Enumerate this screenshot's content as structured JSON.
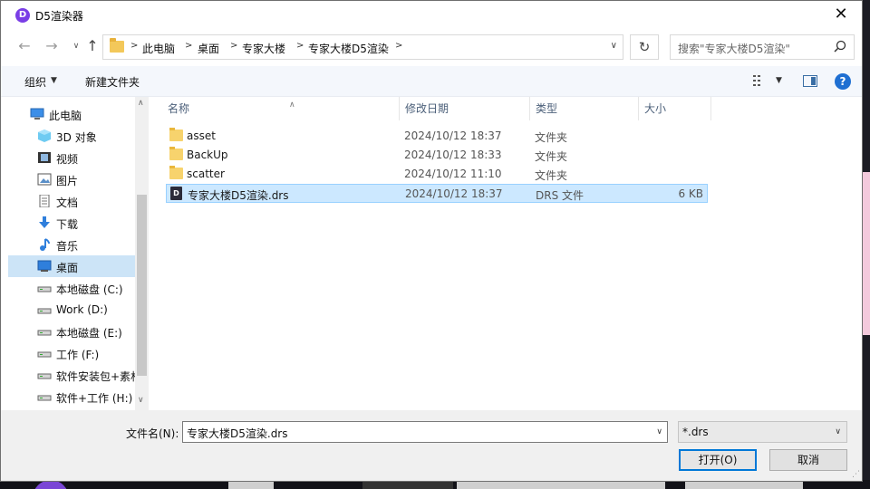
{
  "window": {
    "title": "D5渲染器",
    "app_icon": "D",
    "close_glyph": "✕"
  },
  "nav": {
    "back_glyph": "←",
    "forward_glyph": "→",
    "recent_glyph": "∨",
    "up_glyph": "↑",
    "refresh_glyph": "↻",
    "breadcrumbs": [
      "此电脑",
      "桌面",
      "专家大楼",
      "专家大楼D5渲染"
    ],
    "search_placeholder": "搜索\"专家大楼D5渲染\""
  },
  "toolbar": {
    "organize_label": "组织",
    "new_folder_label": "新建文件夹",
    "help_glyph": "?"
  },
  "sidebar": {
    "items": [
      {
        "label": "此电脑",
        "icon": "computer-icon",
        "root": true
      },
      {
        "label": "3D 对象",
        "icon": "3d-objects-icon"
      },
      {
        "label": "视频",
        "icon": "video-icon"
      },
      {
        "label": "图片",
        "icon": "picture-icon"
      },
      {
        "label": "文档",
        "icon": "document-icon"
      },
      {
        "label": "下载",
        "icon": "download-icon"
      },
      {
        "label": "音乐",
        "icon": "music-icon"
      },
      {
        "label": "桌面",
        "icon": "desktop-icon",
        "selected": true
      },
      {
        "label": "本地磁盘 (C:)",
        "icon": "drive-icon"
      },
      {
        "label": "Work (D:)",
        "icon": "drive-icon"
      },
      {
        "label": "本地磁盘 (E:)",
        "icon": "drive-icon"
      },
      {
        "label": "工作 (F:)",
        "icon": "drive-icon"
      },
      {
        "label": "软件安装包+素材",
        "icon": "drive-icon"
      },
      {
        "label": "软件+工作 (H:)",
        "icon": "drive-icon"
      }
    ]
  },
  "file_list": {
    "columns": [
      "名称",
      "修改日期",
      "类型",
      "大小"
    ],
    "rows": [
      {
        "name": "asset",
        "date": "2024/10/12 18:37",
        "type": "文件夹",
        "size": "",
        "icon": "folder-icon"
      },
      {
        "name": "BackUp",
        "date": "2024/10/12 18:33",
        "type": "文件夹",
        "size": "",
        "icon": "folder-icon"
      },
      {
        "name": "scatter",
        "date": "2024/10/12 11:10",
        "type": "文件夹",
        "size": "",
        "icon": "folder-icon"
      },
      {
        "name": "专家大楼D5渲染.drs",
        "date": "2024/10/12 18:37",
        "type": "DRS 文件",
        "size": "6 KB",
        "icon": "drs-file-icon",
        "selected": true
      }
    ]
  },
  "footer": {
    "filename_label": "文件名(N):",
    "filename_value": "专家大楼D5渲染.drs",
    "filter_value": "*.drs",
    "open_label": "打开(O)",
    "cancel_label": "取消"
  },
  "colors": {
    "accent": "#0078d7",
    "selection": "#cce8ff",
    "nav_selection": "#cce4f7"
  }
}
